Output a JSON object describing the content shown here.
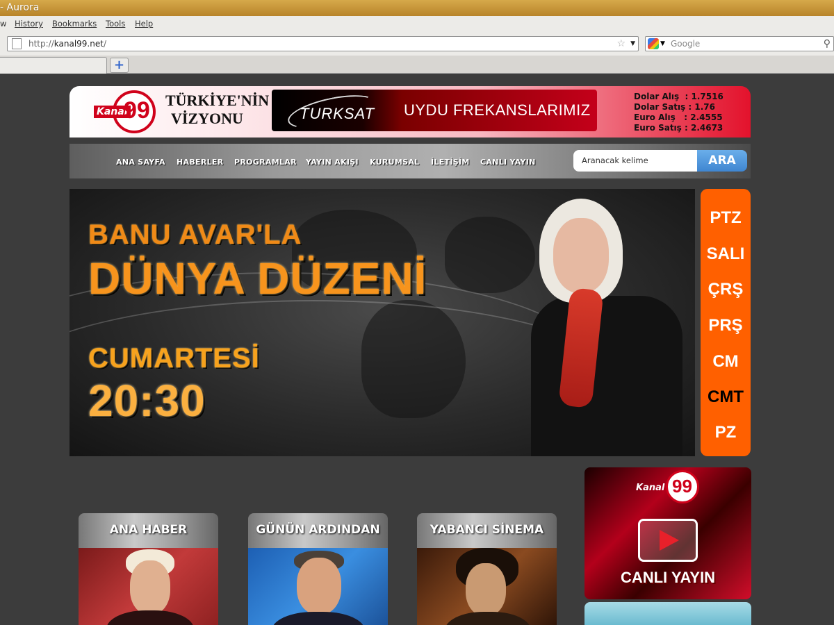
{
  "browser": {
    "title": "- Aurora",
    "menu": [
      "w",
      "History",
      "Bookmarks",
      "Tools",
      "Help"
    ],
    "url_prefix": "http://",
    "url_host": "kanal99.net",
    "url_suffix": "/",
    "search_placeholder": "Google"
  },
  "header": {
    "logo_kanal": "Kanal",
    "logo_number": "99",
    "slogan": "TÜRKİYE'NİN VİZYONU",
    "turksat_logo": "TURKSAT",
    "turksat_text": "UYDU FREKANSLARIMIZ",
    "rates": [
      "Dolar Alış  : 1.7516",
      "Dolar Satış : 1.76",
      "Euro Alış   : 2.4555",
      "Euro Satış : 2.4673"
    ]
  },
  "nav": {
    "items": [
      "ANA SAYFA",
      "HABERLER",
      "PROGRAMLAR",
      "YAYIN AKIŞI",
      "KURUMSAL",
      "İLETİŞİM",
      "CANLI YAYIN"
    ],
    "search_placeholder": "Aranacak kelime",
    "search_button": "ARA"
  },
  "hero": {
    "line1": "BANU AVAR'LA",
    "line2": "DÜNYA DÜZENİ",
    "line3": "CUMARTESİ",
    "line4": "20:30"
  },
  "days": {
    "items": [
      "PTZ",
      "SALI",
      "ÇRŞ",
      "PRŞ",
      "CM",
      "CMT",
      "PZ"
    ],
    "active_color": "#000000",
    "bg_color": "#ff6000"
  },
  "cards": [
    "ANA HABER",
    "GÜNÜN ARDINDAN",
    "YABANCI SİNEMA"
  ],
  "live": {
    "logo_kanal": "Kanal",
    "logo_number": "99",
    "label": "CANLI YAYIN"
  },
  "colors": {
    "brand_red": "#d0021b",
    "search_blue": "#3f86d1",
    "hero_orange": "#f7941d"
  }
}
